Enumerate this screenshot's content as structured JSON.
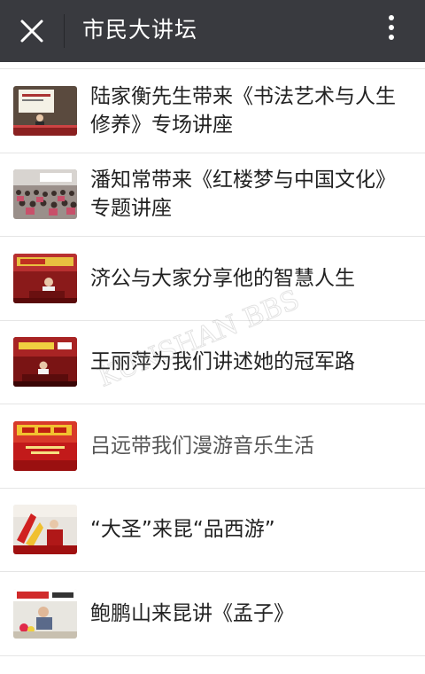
{
  "header": {
    "title": "市民大讲坛",
    "close_icon": "close-icon",
    "more_icon": "more-vertical-icon"
  },
  "articles": [
    {
      "title": "陆家衡先生带来《书法艺术与人生修养》专场讲座",
      "thumb": "lecture-hall-thumbnail"
    },
    {
      "title": "潘知常带来《红楼梦与中国文化》专题讲座",
      "thumb": "audience-thumbnail"
    },
    {
      "title": "济公与大家分享他的智慧人生",
      "thumb": "stage-thumbnail"
    },
    {
      "title": "王丽萍为我们讲述她的冠军路",
      "thumb": "stage-thumbnail"
    },
    {
      "title": "吕远带我们漫游音乐生活",
      "thumb": "banner-thumbnail",
      "visited": true
    },
    {
      "title": "“大圣”来昆“品西游”",
      "thumb": "performer-thumbnail"
    },
    {
      "title": "鲍鹏山来昆讲《孟子》",
      "thumb": "speaker-thumbnail"
    }
  ],
  "colors": {
    "topbar": "#393a3f",
    "text": "#222222",
    "visited_text": "#555555",
    "divider": "#e5e5e5"
  }
}
